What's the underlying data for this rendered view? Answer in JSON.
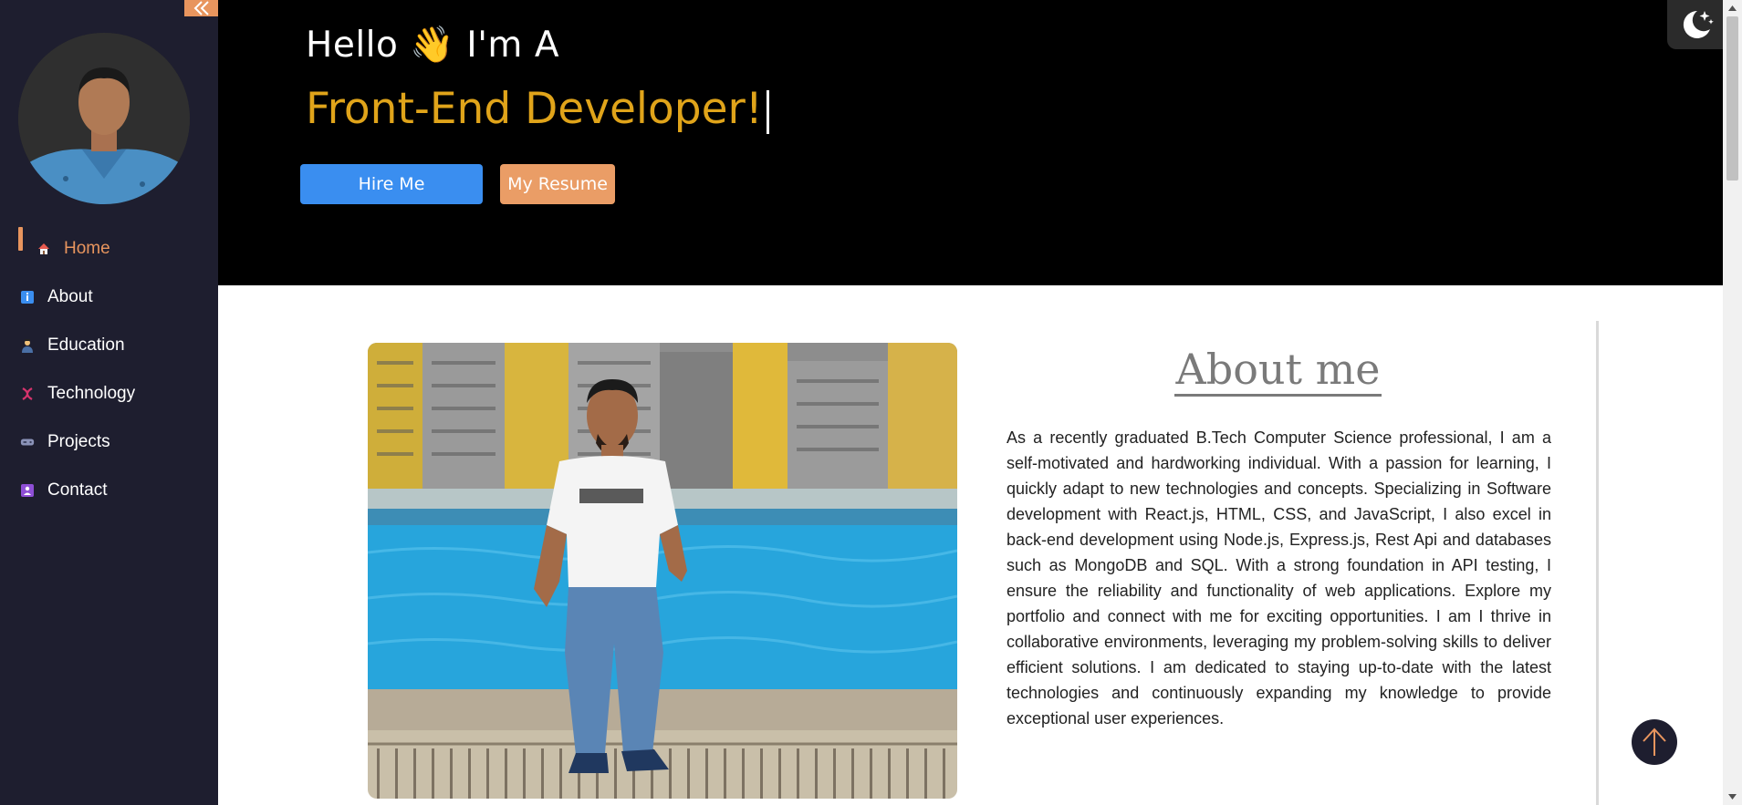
{
  "sidebar": {
    "collapse_icon": "double-chevron-left-icon",
    "nav": [
      {
        "label": "Home",
        "icon": "home-icon",
        "active": true
      },
      {
        "label": "About",
        "icon": "info-icon"
      },
      {
        "label": "Education",
        "icon": "student-icon"
      },
      {
        "label": "Technology",
        "icon": "dna-icon"
      },
      {
        "label": "Projects",
        "icon": "video-game-icon"
      },
      {
        "label": "Contact",
        "icon": "contact-card-icon"
      }
    ]
  },
  "hero": {
    "greeting": "Hello 👋 I'm A",
    "role": "Front-End Developer!",
    "hire_label": "Hire Me",
    "resume_label": "My Resume"
  },
  "about": {
    "title": "About me",
    "text": "As a recently graduated B.Tech Computer Science professional, I am a self-motivated and hardworking individual. With a passion for learning, I quickly adapt to new technologies and concepts. Specializing in Software development with React.js, HTML, CSS, and JavaScript, I also excel in back-end development using Node.js, Express.js, Rest Api and databases such as MongoDB and SQL. With a strong foundation in API testing, I ensure the reliability and functionality of web applications. Explore my portfolio and connect with me for exciting opportunities. I am I thrive in collaborative environments, leveraging my problem-solving skills to deliver efficient solutions. I am dedicated to staying up-to-date with the latest technologies and continuously expanding my knowledge to provide exceptional user experiences."
  },
  "colors": {
    "sidebar_bg": "#1e1e2f",
    "accent": "#e8955e",
    "role_text": "#e0a41a",
    "hire_btn": "#3a8ef0",
    "resume_btn": "#ea9d66"
  }
}
